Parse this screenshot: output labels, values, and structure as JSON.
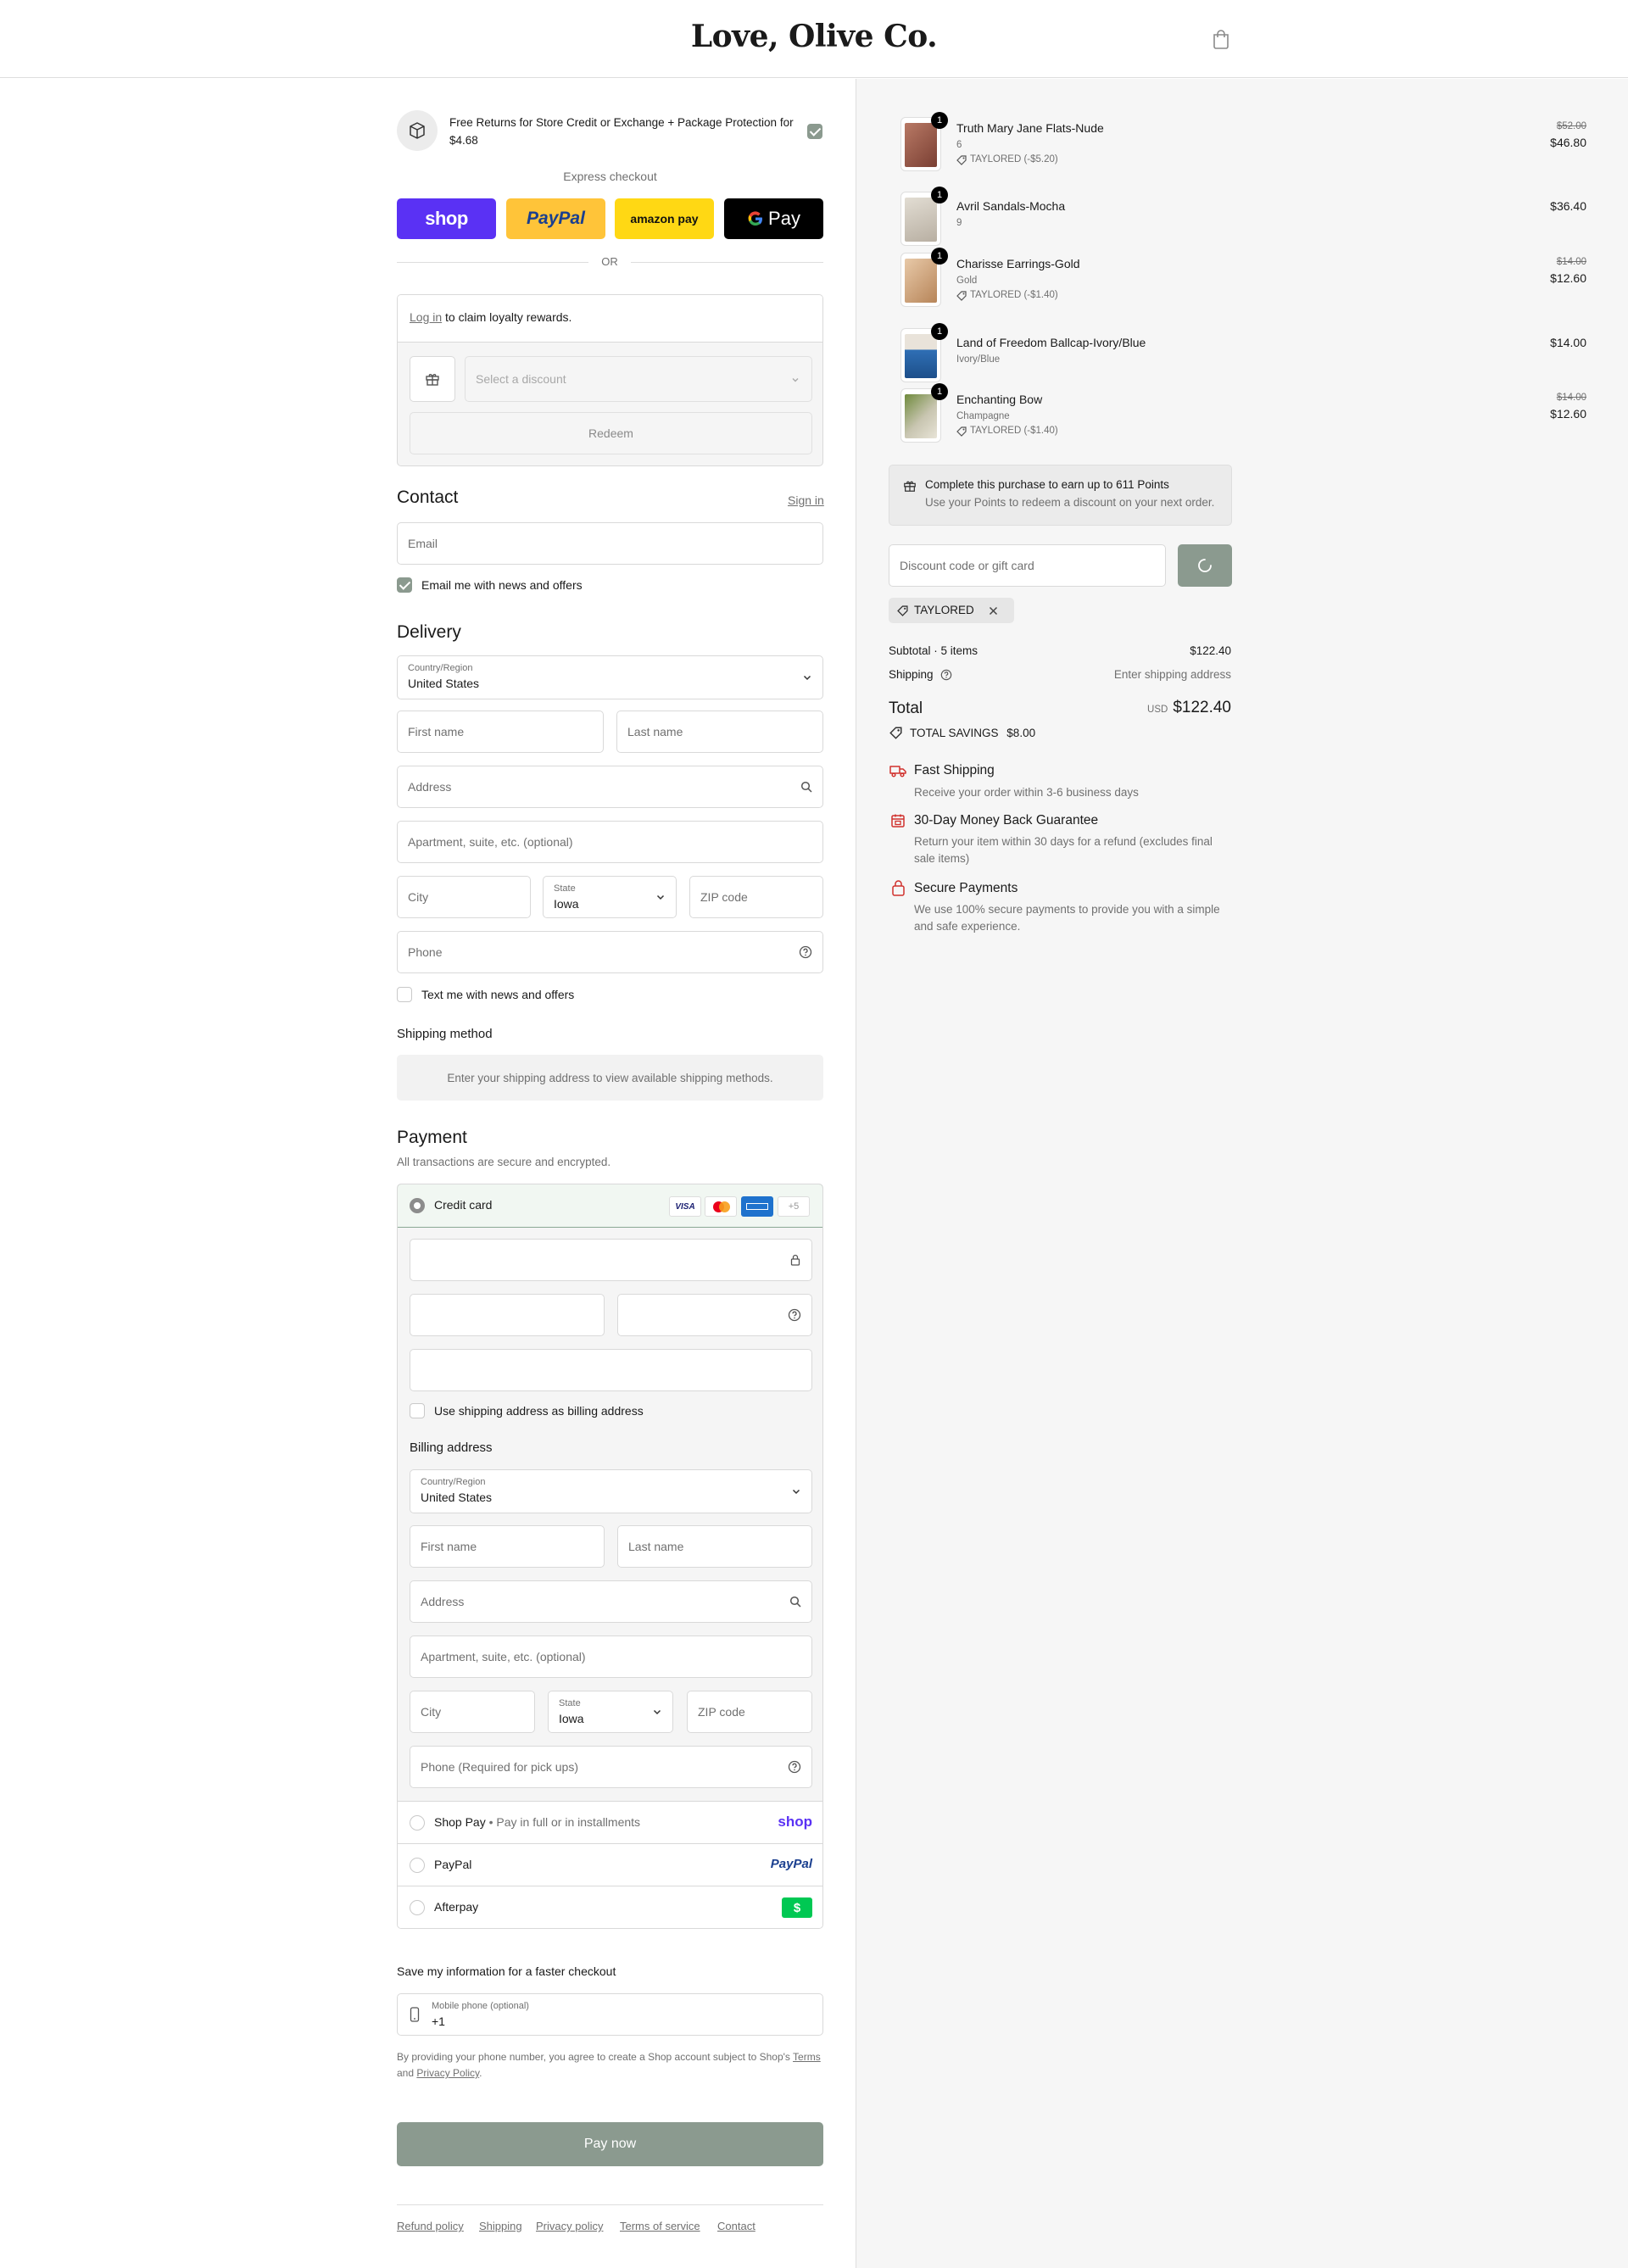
{
  "header": {
    "logo": "Love, Olive Co."
  },
  "protection": {
    "text": "Free Returns for Store Credit or Exchange + Package Protection for $4.68"
  },
  "express": {
    "label": "Express checkout",
    "shop_label": "shop",
    "paypal_label": "PayPal",
    "amazon_label": "amazon pay",
    "gpay_label": "Pay",
    "or_label": "OR"
  },
  "loyalty": {
    "login_link": "Log in",
    "login_text": "to claim loyalty rewards.",
    "discount_placeholder": "Select a discount",
    "redeem_label": "Redeem"
  },
  "contact": {
    "title": "Contact",
    "signin": "Sign in",
    "email_placeholder": "Email",
    "news_label": "Email me with news and offers"
  },
  "delivery": {
    "title": "Delivery",
    "country_label": "Country/Region",
    "country_value": "United States",
    "first_name": "First name",
    "last_name": "Last name",
    "address": "Address",
    "apartment": "Apartment, suite, etc. (optional)",
    "city": "City",
    "state_label": "State",
    "state_value": "Iowa",
    "zip": "ZIP code",
    "phone": "Phone",
    "text_label": "Text me with news and offers"
  },
  "shipping": {
    "title": "Shipping method",
    "notice": "Enter your shipping address to view available shipping methods."
  },
  "payment": {
    "title": "Payment",
    "subtitle": "All transactions are secure and encrypted.",
    "credit_card": "Credit card",
    "card_visa": "VISA",
    "more_cards": "+5",
    "billing_same": "Use shipping address as billing address",
    "billing_title": "Billing address",
    "billing_country_label": "Country/Region",
    "billing_country_value": "United States",
    "billing_first": "First name",
    "billing_last": "Last name",
    "billing_address": "Address",
    "billing_apartment": "Apartment, suite, etc. (optional)",
    "billing_city": "City",
    "billing_state_label": "State",
    "billing_state_value": "Iowa",
    "billing_zip": "ZIP code",
    "billing_phone": "Phone (Required for pick ups)",
    "shoppay": "Shop Pay",
    "shoppay_sub": "Pay in full or in installments",
    "shoppay_logo": "shop",
    "paypal": "PayPal",
    "paypal_logo": "PayPal",
    "afterpay": "Afterpay"
  },
  "save_info": {
    "title": "Save my information for a faster checkout",
    "mobile_label": "Mobile phone (optional)",
    "mobile_value": "+1",
    "legal_1": "By providing your phone number, you agree to create a Shop account subject to Shop's",
    "legal_terms": "Terms",
    "legal_and": "and",
    "legal_privacy": "Privacy Policy",
    "legal_dot": "."
  },
  "pay_now": "Pay now",
  "footer": {
    "refund": "Refund policy",
    "shipping": "Shipping",
    "privacy": "Privacy policy",
    "terms": "Terms of service",
    "contact": "Contact"
  },
  "order": {
    "items": [
      {
        "name": "Truth Mary Jane Flats-Nude",
        "variant": "6",
        "discount": "TAYLORED (-$5.20)",
        "original": "$52.00",
        "price": "$46.80",
        "qty": "1"
      },
      {
        "name": "Avril Sandals-Mocha",
        "variant": "9",
        "discount": "",
        "original": "",
        "price": "$36.40",
        "qty": "1"
      },
      {
        "name": "Charisse Earrings-Gold",
        "variant": "Gold",
        "discount": "TAYLORED (-$1.40)",
        "original": "$14.00",
        "price": "$12.60",
        "qty": "1"
      },
      {
        "name": "Land of Freedom Ballcap-Ivory/Blue",
        "variant": "Ivory/Blue",
        "discount": "",
        "original": "",
        "price": "$14.00",
        "qty": "1"
      },
      {
        "name": "Enchanting Bow",
        "variant": "Champagne",
        "discount": "TAYLORED (-$1.40)",
        "original": "$14.00",
        "price": "$12.60",
        "qty": "1"
      }
    ],
    "points_title": "Complete this purchase to earn up to 611 Points",
    "points_sub": "Use your Points to redeem a discount on your next order.",
    "discount_placeholder": "Discount code or gift card",
    "applied_code": "TAYLORED",
    "subtotal_label": "Subtotal · 5 items",
    "subtotal_value": "$122.40",
    "shipping_label": "Shipping",
    "shipping_value": "Enter shipping address",
    "total_label": "Total",
    "total_currency": "USD",
    "total_value": "$122.40",
    "savings_label": "TOTAL SAVINGS",
    "savings_value": "$8.00"
  },
  "benefits": [
    {
      "title": "Fast Shipping",
      "desc": "Receive your order within 3-6 business days"
    },
    {
      "title": "30-Day Money Back Guarantee",
      "desc": "Return your item within 30 days for a refund (excludes final sale items)"
    },
    {
      "title": "Secure Payments",
      "desc": "We use 100% secure payments to provide you with a simple and safe experience."
    }
  ],
  "colors": {
    "accent": "#8b9a8f",
    "shop_purple": "#5a31f4",
    "paypal_yellow": "#ffc439",
    "amazon_yellow": "#ffd814",
    "benefit_red": "#d0312d",
    "afterpay_green": "#00c853"
  }
}
